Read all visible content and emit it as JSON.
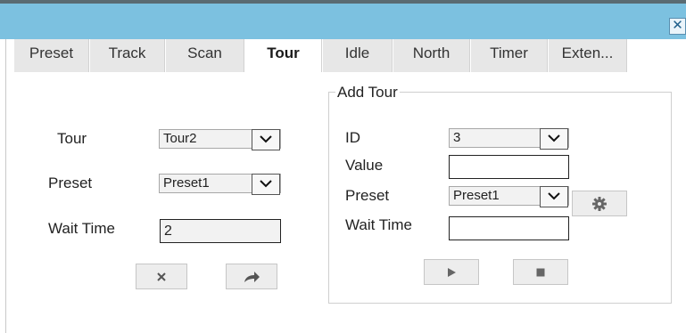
{
  "window": {
    "close_icon": "close-icon"
  },
  "tabs": [
    {
      "label": "Preset"
    },
    {
      "label": "Track"
    },
    {
      "label": "Scan"
    },
    {
      "label": "Tour",
      "active": true
    },
    {
      "label": "Idle"
    },
    {
      "label": "North"
    },
    {
      "label": "Timer"
    },
    {
      "label": "Exten..."
    }
  ],
  "left": {
    "tour_label": "Tour",
    "tour_value": "Tour2",
    "preset_label": "Preset",
    "preset_value": "Preset1",
    "wait_label": "Wait Time",
    "wait_value": "2",
    "delete_icon": "x-icon",
    "goto_icon": "arrow-right-icon"
  },
  "add_tour": {
    "legend": "Add Tour",
    "id_label": "ID",
    "id_value": "3",
    "value_label": "Value",
    "value_value": "",
    "preset_label": "Preset",
    "preset_value": "Preset1",
    "wait_label": "Wait Time",
    "wait_value": "",
    "settings_icon": "gear-icon",
    "play_icon": "play-icon",
    "stop_icon": "stop-icon"
  }
}
